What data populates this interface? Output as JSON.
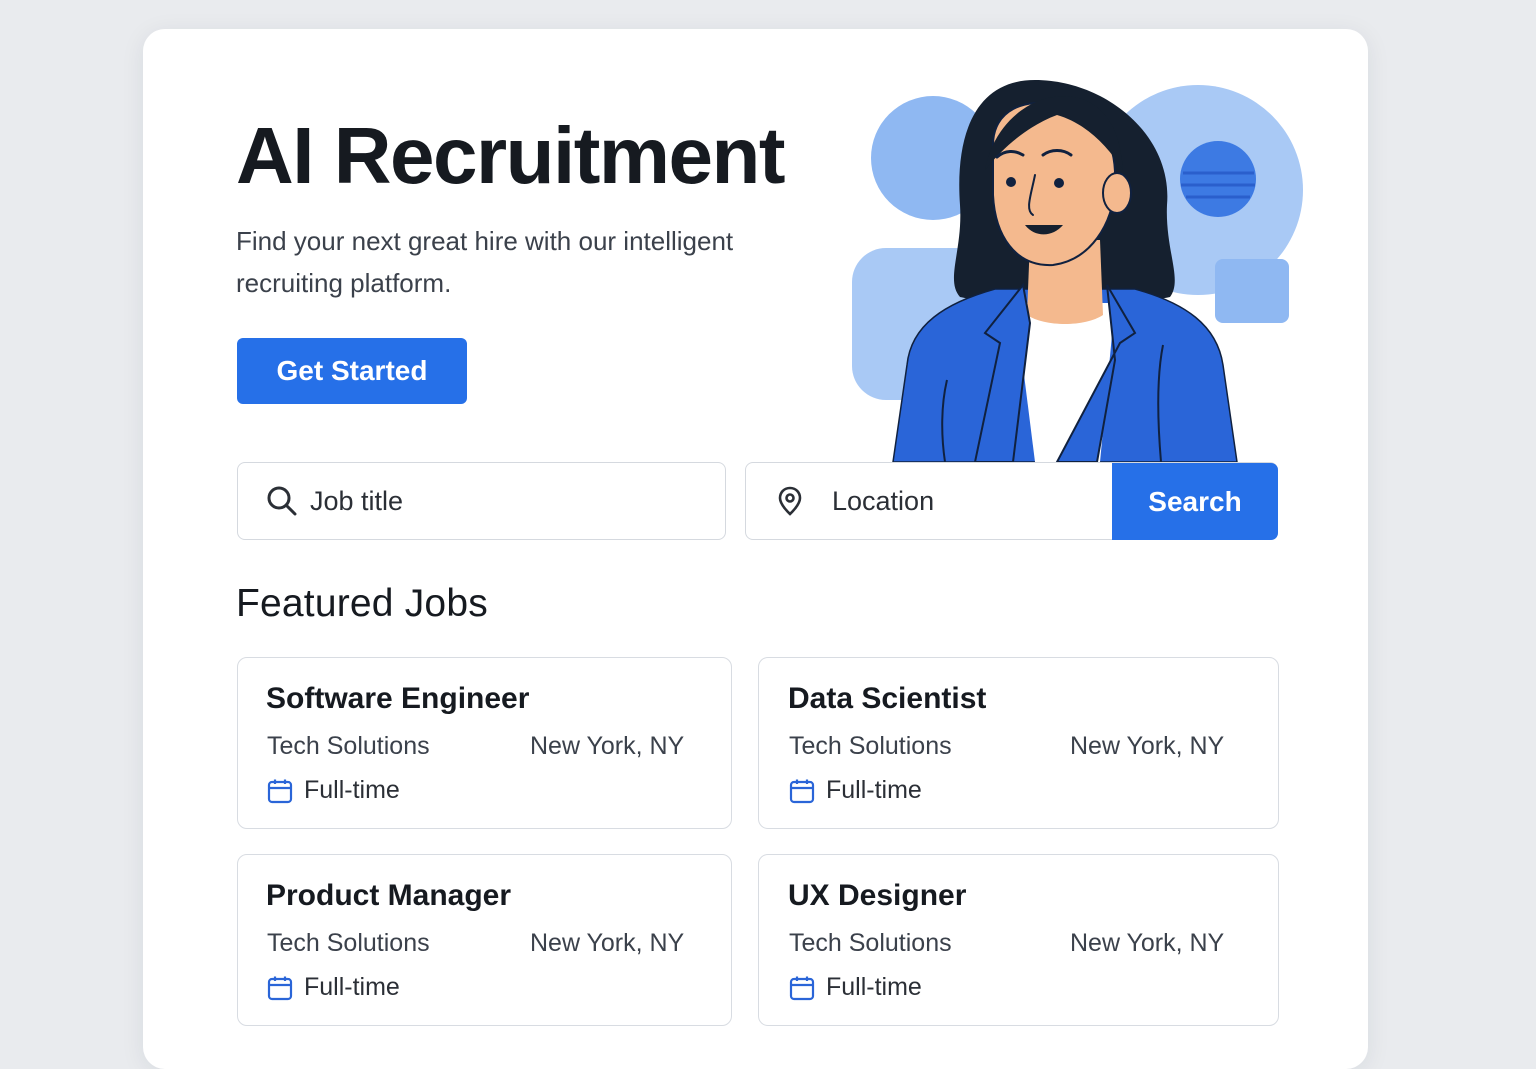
{
  "hero": {
    "title": "AI Recruitment",
    "subtitle": "Find your next great hire with our intelligent recruiting platform.",
    "cta_label": "Get Started"
  },
  "search": {
    "job_placeholder": "Job title",
    "job_icon": "search-icon",
    "location_placeholder": "Location",
    "location_icon": "map-pin-icon",
    "button_label": "Search"
  },
  "featured": {
    "title": "Featured Jobs",
    "jobs": [
      {
        "title": "Software Engineer",
        "company": "Tech Solutions",
        "location": "New York, NY",
        "type": "Full-time"
      },
      {
        "title": "Data Scientist",
        "company": "Tech Solutions",
        "location": "New York, NY",
        "type": "Full-time"
      },
      {
        "title": "Product Manager",
        "company": "Tech Solutions",
        "location": "New York, NY",
        "type": "Full-time"
      },
      {
        "title": "UX Designer",
        "company": "Tech Solutions",
        "location": "New York, NY",
        "type": "Full-time"
      }
    ]
  },
  "colors": {
    "accent": "#2670e8",
    "background": "#e9ebee",
    "card": "#ffffff",
    "illustration_light": "#a9c9f5",
    "illustration_mid": "#8fb8f2",
    "jacket": "#2a65d8",
    "skin": "#f4b98e",
    "hair": "#15202f"
  }
}
